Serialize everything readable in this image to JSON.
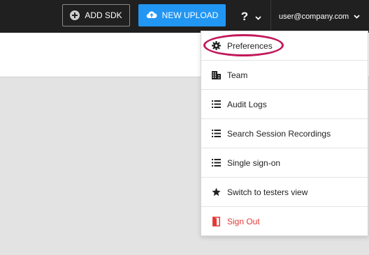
{
  "topbar": {
    "add_sdk_label": "ADD SDK",
    "new_upload_label": "NEW UPLOAD",
    "help_label": "?",
    "user_email": "user@company.com"
  },
  "menu": {
    "items": [
      {
        "label": "Preferences",
        "icon": "gear-icon"
      },
      {
        "label": "Team",
        "icon": "building-icon"
      },
      {
        "label": "Audit Logs",
        "icon": "list-icon"
      },
      {
        "label": "Search Session Recordings",
        "icon": "list-icon"
      },
      {
        "label": "Single sign-on",
        "icon": "list-icon"
      },
      {
        "label": "Switch to testers view",
        "icon": "star-icon"
      },
      {
        "label": "Sign Out",
        "icon": "door-icon"
      }
    ]
  },
  "colors": {
    "topbar_bg": "#202020",
    "upload_button": "#2196f3",
    "signout": "#e53935",
    "highlight": "#c2185b"
  }
}
